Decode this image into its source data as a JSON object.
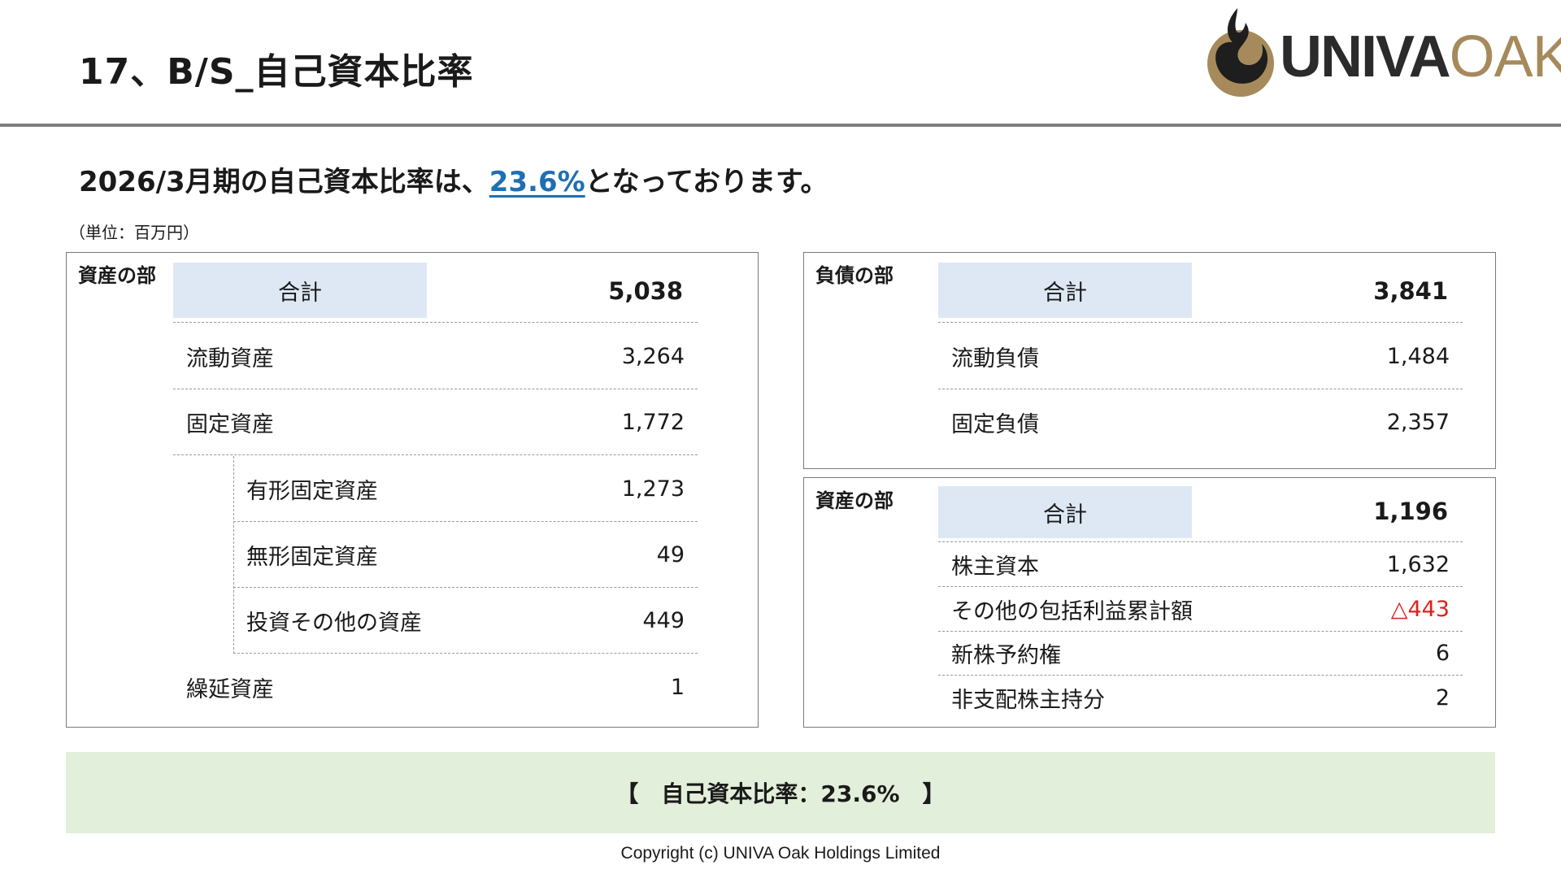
{
  "header": {
    "title": "17、B/S_自己資本比率",
    "logo": {
      "text_main": "UNIVA",
      "text_accent": "OAK",
      "icon": "flame-drop-icon",
      "colors": {
        "main": "#2b2b2b",
        "accent": "#a68a5b"
      }
    }
  },
  "headline": {
    "prefix": "2026/3月期の自己資本比率は、",
    "highlight": "23.6%",
    "suffix": "となっております。",
    "highlight_color": "#1f6fb3"
  },
  "unit_note": "（単位：百万円）",
  "assets": {
    "label": "資産の部",
    "total": {
      "label": "合計",
      "value": "5,038"
    },
    "rows": [
      {
        "label": "流動資産",
        "value": "3,264"
      },
      {
        "label": "固定資産",
        "value": "1,772"
      }
    ],
    "sub_rows": [
      {
        "label": "有形固定資産",
        "value": "1,273"
      },
      {
        "label": "無形固定資産",
        "value": "49"
      },
      {
        "label": "投資その他の資産",
        "value": "449"
      }
    ],
    "last_row": {
      "label": "繰延資産",
      "value": "1"
    }
  },
  "liabilities": {
    "label": "負債の部",
    "total": {
      "label": "合計",
      "value": "3,841"
    },
    "rows": [
      {
        "label": "流動負債",
        "value": "1,484"
      },
      {
        "label": "固定負債",
        "value": "2,357"
      }
    ]
  },
  "equity": {
    "label": "資産の部",
    "total": {
      "label": "合計",
      "value": "1,196"
    },
    "rows": [
      {
        "label": "株主資本",
        "value": "1,632"
      },
      {
        "label": "その他の包括利益累計額",
        "value": "△443",
        "negative": true,
        "color": "#e0201b"
      },
      {
        "label": "新株予約権",
        "value": "6"
      },
      {
        "label": "非支配株主持分",
        "value": "2"
      }
    ]
  },
  "ratio_banner": "【　自己資本比率：23.6%　】",
  "footer": {
    "copyright": "Copyright (c) UNIVA Oak Holdings Limited"
  },
  "colors": {
    "total_cell_bg": "#dde8f4",
    "banner_bg": "#e2efda",
    "divider": "#7f7f7f"
  }
}
